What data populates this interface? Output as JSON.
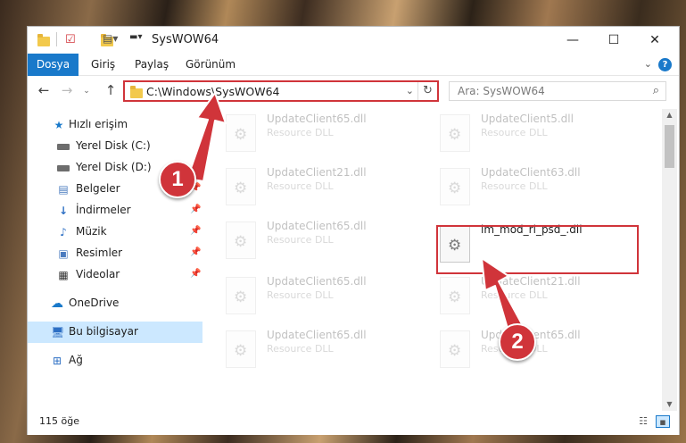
{
  "window": {
    "title": "SysWOW64",
    "minimize": "—",
    "maximize": "☐",
    "close": "✕"
  },
  "ribbon": {
    "tabs": [
      "Dosya",
      "Giriş",
      "Paylaş",
      "Görünüm"
    ],
    "help": "?"
  },
  "nav": {
    "address": "C:\\Windows\\SysWOW64",
    "search_placeholder": "Ara: SysWOW64"
  },
  "sidebar": {
    "items": [
      {
        "label": "Hızlı erişim",
        "icon": "star-icon",
        "pinned": false
      },
      {
        "label": "Yerel Disk (C:)",
        "icon": "disk-icon",
        "pinned": true
      },
      {
        "label": "Yerel Disk (D:)",
        "icon": "disk-icon",
        "pinned": true
      },
      {
        "label": "Belgeler",
        "icon": "documents-icon",
        "pinned": true
      },
      {
        "label": "İndirmeler",
        "icon": "download-icon",
        "pinned": true
      },
      {
        "label": "Müzik",
        "icon": "music-icon",
        "pinned": true
      },
      {
        "label": "Resimler",
        "icon": "pictures-icon",
        "pinned": true
      },
      {
        "label": "Videolar",
        "icon": "video-icon",
        "pinned": true
      },
      {
        "label": "OneDrive",
        "icon": "cloud-icon",
        "pinned": false
      },
      {
        "label": "Bu bilgisayar",
        "icon": "computer-icon",
        "pinned": false,
        "selected": true
      },
      {
        "label": "Ağ",
        "icon": "network-icon",
        "pinned": false
      }
    ]
  },
  "files": [
    {
      "name": "UpdateClient65.dll",
      "type": "Resource DLL",
      "faded": true
    },
    {
      "name": "UpdateClient5.dll",
      "type": "Resource DLL",
      "faded": true
    },
    {
      "name": "UpdateClient21.dll",
      "type": "Resource DLL",
      "faded": true
    },
    {
      "name": "UpdateClient63.dll",
      "type": "Resource DLL",
      "faded": true
    },
    {
      "name": "UpdateClient65.dll",
      "type": "Resource DLL",
      "faded": true
    },
    {
      "name": "im_mod_rl_psd_.dll",
      "type": "",
      "faded": false,
      "highlighted": true
    },
    {
      "name": "UpdateClient65.dll",
      "type": "Resource DLL",
      "faded": true
    },
    {
      "name": "UpdateClient21.dll",
      "type": "Resource DLL",
      "faded": true
    },
    {
      "name": "UpdateClient65.dll",
      "type": "Resource DLL",
      "faded": true
    },
    {
      "name": "UpdateClient65.dll",
      "type": "Resource DLL",
      "faded": true
    }
  ],
  "status": {
    "item_count": "115 öğe"
  },
  "annotations": {
    "badge_1": "1",
    "badge_2": "2",
    "color": "#d0343a"
  }
}
